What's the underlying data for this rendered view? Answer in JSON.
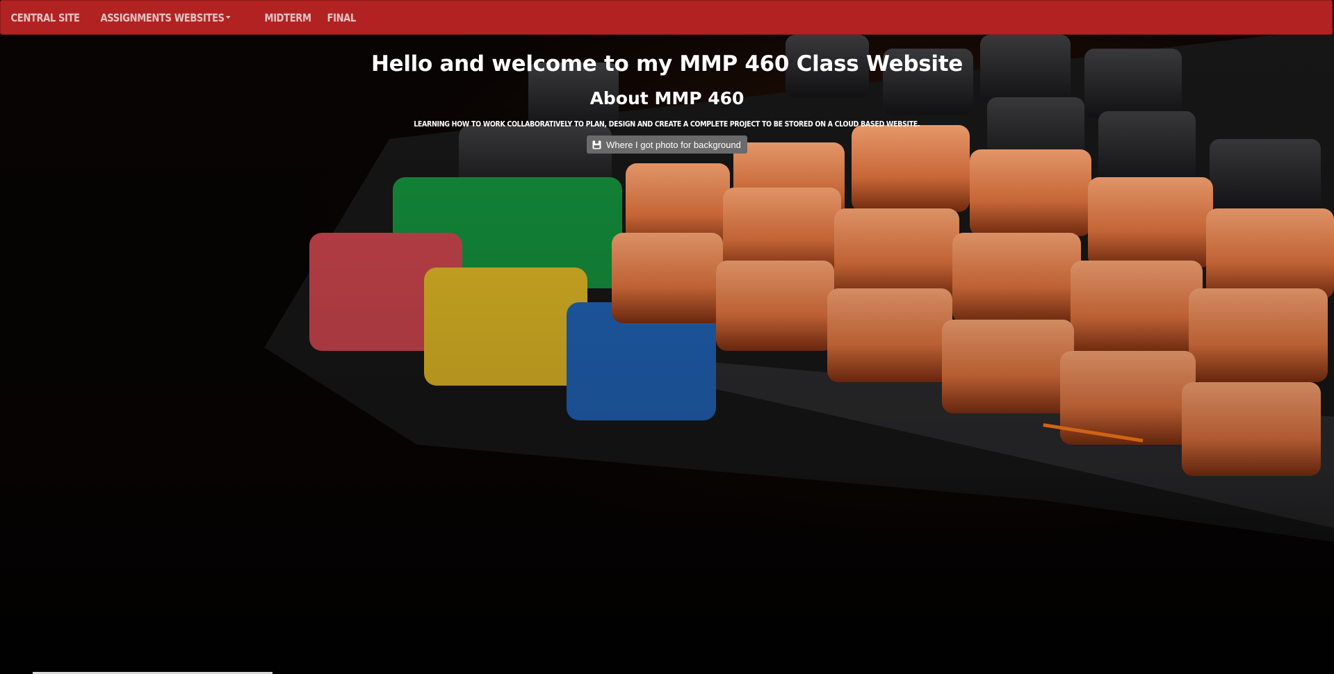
{
  "nav": {
    "items": [
      {
        "label": "Central Site"
      },
      {
        "label": "Assignments Websites"
      },
      {
        "label": "Midterm"
      },
      {
        "label": "Final"
      }
    ]
  },
  "hero": {
    "title": "Hello and welcome to my MMP 460 Class Website",
    "subtitle": "About MMP 460",
    "description": "Learning how to work collaboratively to plan, design and create a complete project to be stored on a cloud based website.",
    "credit_button": "Where I got photo for background"
  },
  "icons": {
    "credit": "camera-icon"
  },
  "colors": {
    "navbar": "#b22222",
    "nav_text": "#e7c3c3",
    "hero_text": "#ffffff",
    "credit_button_bg": "#6a6a6a"
  }
}
